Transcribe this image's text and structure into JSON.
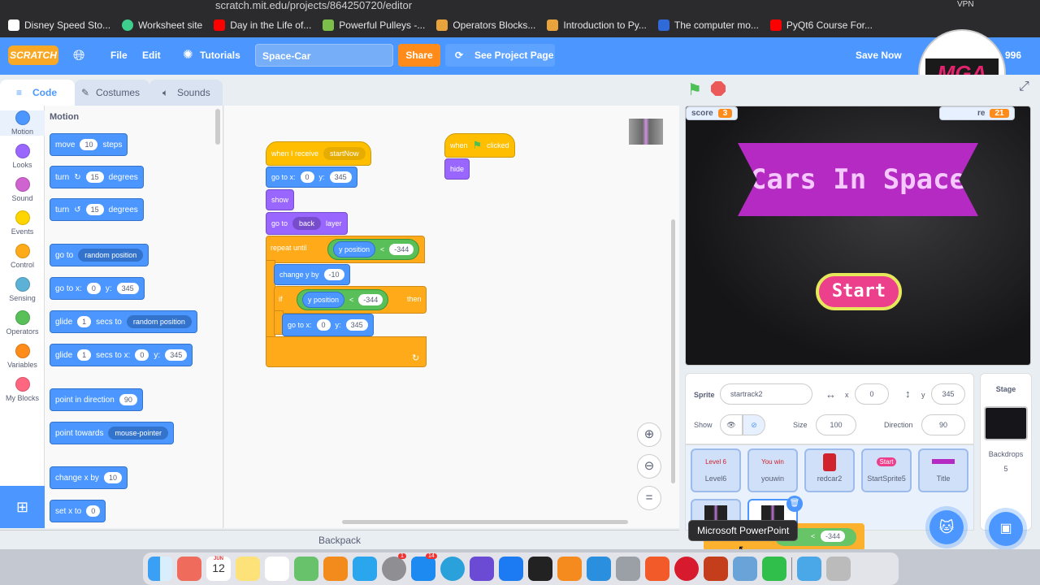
{
  "browser": {
    "url": "scratch.mit.edu/projects/864250720/editor",
    "bookmarks": [
      "Disney Speed Sto...",
      "Worksheet site",
      "Day in the Life of...",
      "Powerful Pulleys -...",
      "Operators Blocks...",
      "Introduction to Py...",
      "The computer mo...",
      "PyQt6 Course For..."
    ],
    "vpn": "VPN"
  },
  "menubar": {
    "logo": "SCRATCH",
    "file": "File",
    "edit": "Edit",
    "tutorials": "Tutorials",
    "project_title": "Space-Car",
    "share": "Share",
    "see_project": "See Project Page",
    "save_now": "Save Now",
    "user_suffix": "996"
  },
  "tabs": {
    "code": "Code",
    "costumes": "Costumes",
    "sounds": "Sounds"
  },
  "categories": [
    {
      "label": "Motion",
      "color": "#4c97ff"
    },
    {
      "label": "Looks",
      "color": "#9966ff"
    },
    {
      "label": "Sound",
      "color": "#cf63cf"
    },
    {
      "label": "Events",
      "color": "#ffd500"
    },
    {
      "label": "Control",
      "color": "#ffab19"
    },
    {
      "label": "Sensing",
      "color": "#5cb1d6"
    },
    {
      "label": "Operators",
      "color": "#59c059"
    },
    {
      "label": "Variables",
      "color": "#ff8c1a"
    },
    {
      "label": "My Blocks",
      "color": "#ff6680"
    }
  ],
  "palette": {
    "heading": "Motion",
    "move": {
      "a": "move",
      "n": "10",
      "b": "steps"
    },
    "turn_right": {
      "a": "turn",
      "n": "15",
      "b": "degrees"
    },
    "turn_left": {
      "a": "turn",
      "n": "15",
      "b": "degrees"
    },
    "goto": {
      "a": "go to",
      "dd": "random position"
    },
    "goto_xy": {
      "a": "go to x:",
      "x": "0",
      "b": "y:",
      "y": "345"
    },
    "glide_to": {
      "a": "glide",
      "n": "1",
      "b": "secs to",
      "dd": "random position"
    },
    "glide_xy": {
      "a": "glide",
      "n": "1",
      "b": "secs to x:",
      "x": "0",
      "c": "y:",
      "y": "345"
    },
    "point_dir": {
      "a": "point in direction",
      "n": "90"
    },
    "point_towards": {
      "a": "point towards",
      "dd": "mouse-pointer"
    },
    "change_x": {
      "a": "change x by",
      "n": "10"
    },
    "set_x": {
      "a": "set x to",
      "n": "0"
    }
  },
  "script1": {
    "hat": "when I receive",
    "msg": "startNow",
    "goto": "go to x:",
    "x": "0",
    "y_lbl": "y:",
    "y": "345",
    "show": "show",
    "layer_a": "go to",
    "layer_dd": "back",
    "layer_b": "layer",
    "repeat": "repeat until",
    "ypos": "y position",
    "lt": "<",
    "val": "-344",
    "change": "change y by",
    "change_val": "-10",
    "if": "if",
    "then": "then",
    "goto2": "go to x:",
    "x2": "0",
    "y2_lbl": "y:",
    "y2": "345"
  },
  "script2": {
    "when": "when",
    "clicked": "clicked",
    "hide": "hide"
  },
  "zoom": {
    "in": "+",
    "out": "−",
    "reset": "="
  },
  "stage": {
    "score_label": "score",
    "score_value": "3",
    "highscore_label": "re",
    "highscore_value": "21",
    "banner": "Cars In Space",
    "start": "Start"
  },
  "sprite": {
    "label": "Sprite",
    "name": "startrack2",
    "x_label": "x",
    "x": "0",
    "y_label": "y",
    "y": "345",
    "show_label": "Show",
    "size_label": "Size",
    "size": "100",
    "direction_label": "Direction",
    "direction": "90"
  },
  "sprites": [
    {
      "name": "Level6",
      "thumb": "Level 6"
    },
    {
      "name": "youwin",
      "thumb": "You win"
    },
    {
      "name": "redcar2",
      "thumb": ""
    },
    {
      "name": "StartSprite5",
      "thumb": "Start"
    },
    {
      "name": "Title",
      "thumb": ""
    }
  ],
  "stage_panel": {
    "label": "Stage",
    "backdrops_label": "Backdrops",
    "backdrops": "5"
  },
  "dragging_value": "-344",
  "backpack": "Backpack",
  "tooltip": "Microsoft PowerPoint",
  "dock": {
    "date_month": "JUN",
    "date_day": "12",
    "badge_a": "1",
    "badge_b": "14"
  }
}
